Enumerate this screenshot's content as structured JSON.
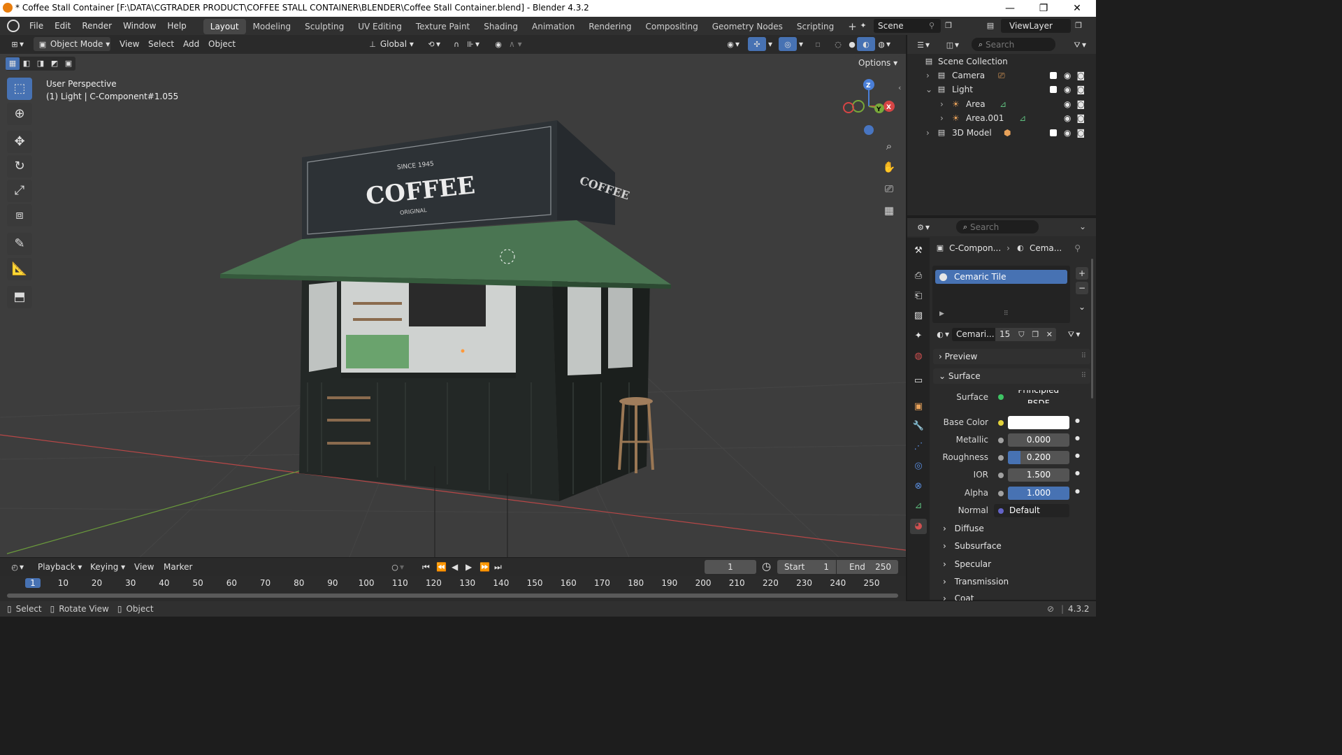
{
  "window": {
    "title": "* Coffee Stall Container [F:\\DATA\\CGTRADER PRODUCT\\COFFEE STALL CONTAINER\\BLENDER\\Coffee Stall Container.blend] - Blender 4.3.2",
    "minimize": "—",
    "maximize": "❐",
    "close": "✕"
  },
  "menu": [
    "File",
    "Edit",
    "Render",
    "Window",
    "Help"
  ],
  "workspaces": [
    "Layout",
    "Modeling",
    "Sculpting",
    "UV Editing",
    "Texture Paint",
    "Shading",
    "Animation",
    "Rendering",
    "Compositing",
    "Geometry Nodes",
    "Scripting"
  ],
  "workspace_add": "+",
  "scene": {
    "name": "Scene",
    "view_layer": "ViewLayer"
  },
  "viewport_header": {
    "mode": "Object Mode",
    "view": "View",
    "select": "Select",
    "add": "Add",
    "object": "Object",
    "transform_orientation": "Global",
    "options": "Options"
  },
  "viewport": {
    "perspective": "User Perspective",
    "selection_info": "(1) Light | C-Component#1.055",
    "sign": {
      "since": "SINCE 1945",
      "brand": "COFFEE",
      "sub": "ORIGINAL",
      "side": "COFFEE"
    },
    "gizmo": {
      "z": "Z",
      "y": "Y",
      "x": "X"
    },
    "colors": {
      "background": "#3d3d3d",
      "roof": "#4a7552",
      "container": "#232826",
      "x_axis": "#b84747",
      "y_axis": "#6a9a3c"
    }
  },
  "outliner": {
    "search_placeholder": "Search",
    "items": [
      {
        "label": "Scene Collection"
      },
      {
        "label": "Camera"
      },
      {
        "label": "Light"
      },
      {
        "label": "Area"
      },
      {
        "label": "Area.001"
      },
      {
        "label": "3D Model"
      }
    ]
  },
  "properties": {
    "search_placeholder": "Search",
    "breadcrumb_object": "C-Compon...",
    "breadcrumb_material": "Cema...",
    "material_slot": "Cemaric Tile",
    "material_name": "Cemari...",
    "user_count": "15",
    "sections": {
      "preview": "Preview",
      "surface": "Surface",
      "diffuse": "Diffuse",
      "subsurface": "Subsurface",
      "specular": "Specular",
      "transmission": "Transmission",
      "coat": "Coat"
    },
    "surface_label": "Surface",
    "surface_value": "Principled BSDF",
    "fields": [
      {
        "label": "Base Color",
        "value": ""
      },
      {
        "label": "Metallic",
        "value": "0.000"
      },
      {
        "label": "Roughness",
        "value": "0.200"
      },
      {
        "label": "IOR",
        "value": "1.500"
      },
      {
        "label": "Alpha",
        "value": "1.000"
      },
      {
        "label": "Normal",
        "value": "Default"
      }
    ],
    "roughness_fill": 0.2,
    "alpha_fill": 1.0
  },
  "timeline": {
    "playback": "Playback",
    "keying": "Keying",
    "view": "View",
    "marker": "Marker",
    "current_frame": "1",
    "start_label": "Start",
    "start": "1",
    "end_label": "End",
    "end": "250",
    "ticks": [
      "1",
      "10",
      "20",
      "30",
      "40",
      "50",
      "60",
      "70",
      "80",
      "90",
      "100",
      "110",
      "120",
      "130",
      "140",
      "150",
      "160",
      "170",
      "180",
      "190",
      "200",
      "210",
      "220",
      "230",
      "240",
      "250"
    ]
  },
  "statusbar": {
    "select": "Select",
    "rotate": "Rotate View",
    "object": "Object",
    "version": "4.3.2"
  }
}
